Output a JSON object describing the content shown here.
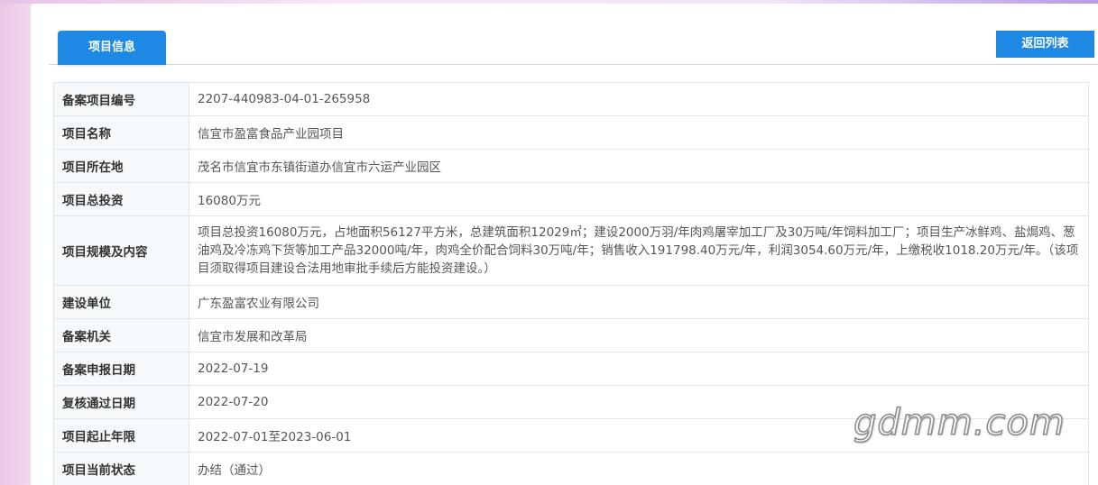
{
  "tabs": {
    "active_label": "项目信息"
  },
  "actions": {
    "back_label": "返回列表"
  },
  "rows": [
    {
      "label": "备案项目编号",
      "value": "2207-440983-04-01-265958"
    },
    {
      "label": "项目名称",
      "value": "信宜市盈富食品产业园项目"
    },
    {
      "label": "项目所在地",
      "value": "茂名市信宜市东镇街道办信宜市六运产业园区"
    },
    {
      "label": "项目总投资",
      "value": "16080万元"
    },
    {
      "label": "项目规模及内容",
      "value": "项目总投资16080万元，占地面积56127平方米，总建筑面积12029㎡；建设2000万羽/年肉鸡屠宰加工厂及30万吨/年饲料加工厂；项目生产冰鲜鸡、盐焗鸡、葱油鸡及冷冻鸡下货等加工产品32000吨/年，肉鸡全价配合饲料30万吨/年；销售收入191798.40万元/年，利润3054.60万元/年，上缴税收1018.20万元/年。（该项目须取得项目建设合法用地审批手续后方能投资建设。）"
    },
    {
      "label": "建设单位",
      "value": "广东盈富农业有限公司"
    },
    {
      "label": "备案机关",
      "value": "信宜市发展和改革局"
    },
    {
      "label": "备案申报日期",
      "value": "2022-07-19"
    },
    {
      "label": "复核通过日期",
      "value": "2022-07-20"
    },
    {
      "label": "项目起止年限",
      "value": "2022-07-01至2023-06-01"
    },
    {
      "label": "项目当前状态",
      "value": "办结（通过）"
    }
  ],
  "watermark": "gdmm.com",
  "colors": {
    "accent": "#1e88e5",
    "label_bg": "#f6f9fb",
    "border": "#e2e6ea"
  }
}
